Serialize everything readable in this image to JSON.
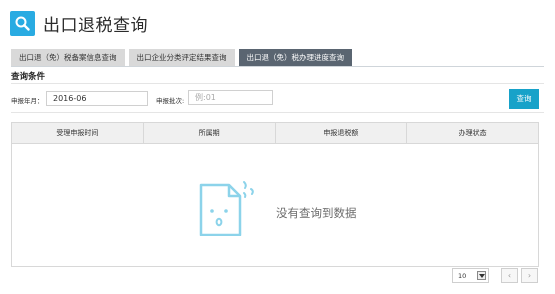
{
  "header": {
    "title": "出口退税查询",
    "icon": "search-icon",
    "accent": "#29abe2"
  },
  "tabs": [
    {
      "label": "出口退（免）税备案信息查询",
      "active": false
    },
    {
      "label": "出口企业分类评定结果查询",
      "active": false
    },
    {
      "label": "出口退（免）税办理进度查询",
      "active": true
    }
  ],
  "criteria": {
    "title": "查询条件",
    "period_label": "申报年月：",
    "period_value": "2016-06",
    "batch_label": "申报批次:",
    "batch_placeholder": "例:01",
    "query_button": "查询"
  },
  "grid": {
    "columns": [
      "受理申报时间",
      "所属期",
      "申报退税额",
      "办理状态"
    ],
    "rows": [],
    "empty_text": "没有查询到数据",
    "empty_icon": "empty-document-icon"
  },
  "pager": {
    "page_size": "10",
    "prev": "‹",
    "next": "›"
  },
  "colors": {
    "primary": "#17a2c9",
    "tab_active": "#5a6571",
    "tab_inactive": "#d9d9d9"
  }
}
